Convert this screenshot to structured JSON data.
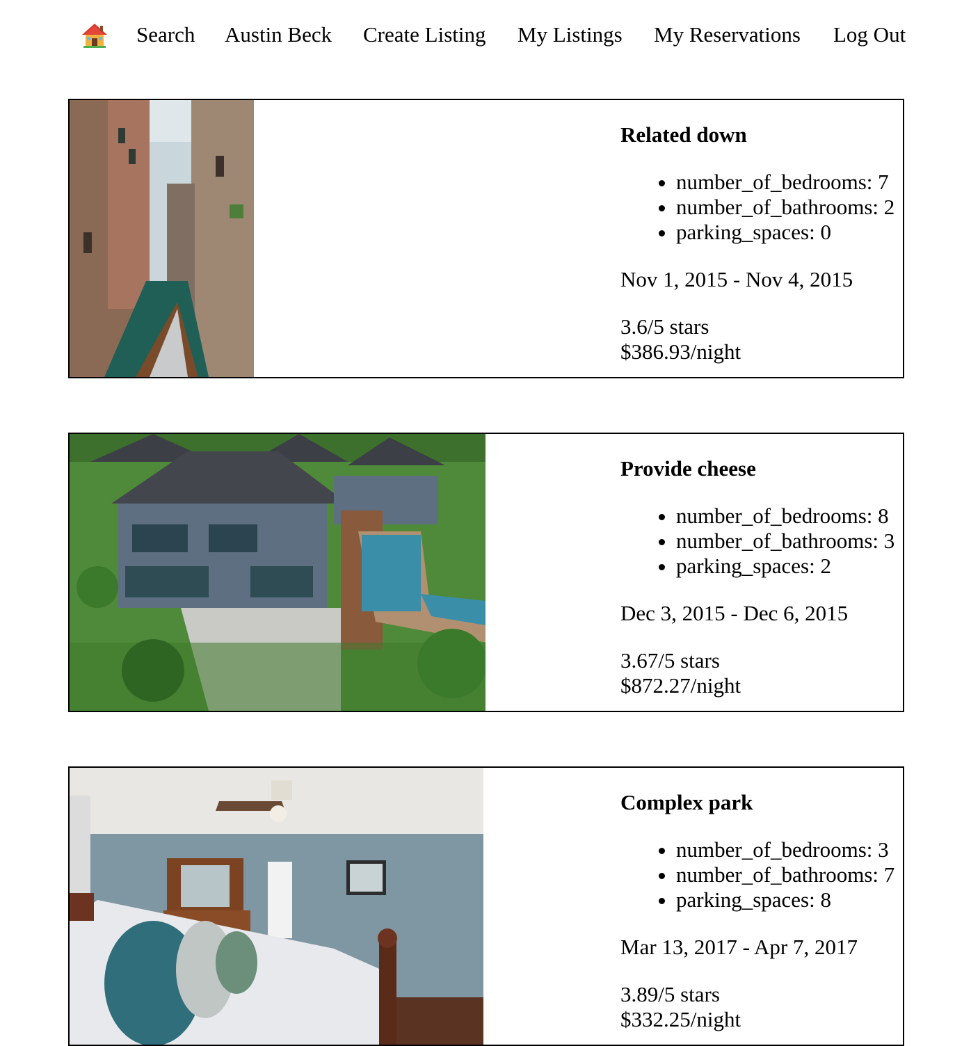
{
  "nav": {
    "home_icon": "house-emoji-icon",
    "links": [
      {
        "label": "Search"
      },
      {
        "label": "Austin Beck"
      },
      {
        "label": "Create Listing"
      },
      {
        "label": "My Listings"
      },
      {
        "label": "My Reservations"
      },
      {
        "label": "Log Out"
      }
    ]
  },
  "listings": [
    {
      "title": "Related down",
      "features": [
        "number_of_bedrooms: 7",
        "number_of_bathrooms: 2",
        "parking_spaces: 0"
      ],
      "dates": "Nov 1, 2015 - Nov 4, 2015",
      "rating": "3.6/5 stars",
      "price": "$386.93/night",
      "image": "venice-canal-photo"
    },
    {
      "title": "Provide cheese",
      "features": [
        "number_of_bedrooms: 8",
        "number_of_bathrooms: 3",
        "parking_spaces: 2"
      ],
      "dates": "Dec 3, 2015 - Dec 6, 2015",
      "rating": "3.67/5 stars",
      "price": "$872.27/night",
      "image": "villa-with-pool-photo"
    },
    {
      "title": "Complex park",
      "features": [
        "number_of_bedrooms: 3",
        "number_of_bathrooms: 7",
        "parking_spaces: 8"
      ],
      "dates": "Mar 13, 2017 - Apr 7, 2017",
      "rating": "3.89/5 stars",
      "price": "$332.25/night",
      "image": "bedroom-photo"
    }
  ]
}
